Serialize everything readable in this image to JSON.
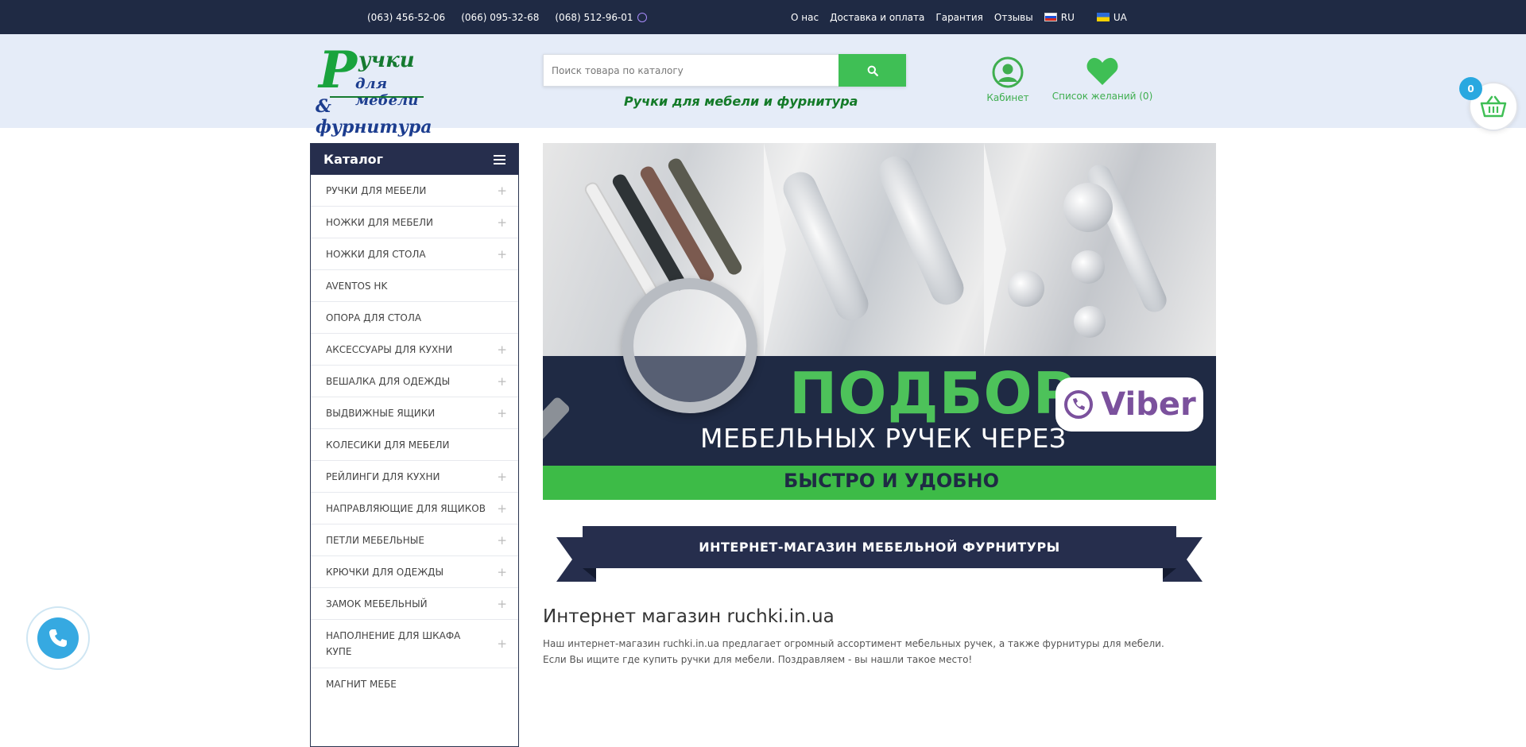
{
  "topbar": {
    "phones": [
      "(063) 456-52-06",
      "(066) 095-32-68",
      "(068) 512-96-01"
    ],
    "nav": [
      "О нас",
      "Доставка и оплата",
      "Гарантия",
      "Отзывы"
    ],
    "lang_ru": "RU",
    "lang_ua": "UA"
  },
  "header": {
    "logo": {
      "r": "Р",
      "line1": "учки",
      "line2": "для мебели",
      "line3": "& фурнитура"
    },
    "search_placeholder": "Поиск товара по каталогу",
    "tagline": "Ручки для мебели и фурнитура",
    "cabinet_label": "Кабинет",
    "wishlist_label": "Список желаний (0)",
    "cart_count": "0"
  },
  "catalog": {
    "title": "Каталог",
    "items": [
      {
        "label": "РУЧКИ ДЛЯ МЕБЕЛИ",
        "plus": "+"
      },
      {
        "label": "НОЖКИ ДЛЯ МЕБЕЛИ",
        "plus": "+"
      },
      {
        "label": "НОЖКИ ДЛЯ СТОЛА",
        "plus": "+"
      },
      {
        "label": "AVENTOS HK",
        "plus": ""
      },
      {
        "label": "ОПОРА ДЛЯ СТОЛА",
        "plus": ""
      },
      {
        "label": "АКСЕССУАРЫ ДЛЯ КУХНИ",
        "plus": "+"
      },
      {
        "label": "ВЕШАЛКА ДЛЯ ОДЕЖДЫ",
        "plus": "+"
      },
      {
        "label": "ВЫДВИЖНЫЕ ЯЩИКИ",
        "plus": "+"
      },
      {
        "label": "КОЛЕСИКИ ДЛЯ МЕБЕЛИ",
        "plus": ""
      },
      {
        "label": "РЕЙЛИНГИ ДЛЯ КУХНИ",
        "plus": "+"
      },
      {
        "label": "НАПРАВЛЯЮЩИЕ ДЛЯ ЯЩИКОВ",
        "plus": "+"
      },
      {
        "label": "ПЕТЛИ МЕБЕЛЬНЫЕ",
        "plus": "+"
      },
      {
        "label": "КРЮЧКИ ДЛЯ ОДЕЖДЫ",
        "plus": "+"
      },
      {
        "label": "ЗАМОК МЕБЕЛЬНЫЙ",
        "plus": "+"
      },
      {
        "label": "НАПОЛНЕНИЕ ДЛЯ ШКАФА КУПЕ",
        "plus": "+"
      },
      {
        "label": "МАГНИТ МЕБЕ",
        "plus": ""
      }
    ]
  },
  "banner": {
    "title": "ПОДБОР",
    "subtitle": "МЕБЕЛЬНЫХ РУЧЕК ЧЕРЕЗ",
    "fast": "БЫСТРО И УДОБНО",
    "viber": "Viber"
  },
  "ribbon_text": "ИНТЕРНЕТ-МАГАЗИН МЕБЕЛЬНОЙ ФУРНИТУРЫ",
  "content": {
    "title": "Интернет магазин ruchki.in.ua",
    "p1": "Наш интернет-магазин ruchki.in.ua предлагает огромный ассортимент мебельных ручек, а также фурнитуры для мебели.",
    "p2": "Если Вы ищите где купить ручки для мебели. Поздравляем - вы нашли такое место!"
  },
  "colors": {
    "navy": "#1f2a44",
    "green": "#3fbf55",
    "cart_badge": "#29a8e0",
    "phone_fab": "#36a9e1"
  }
}
